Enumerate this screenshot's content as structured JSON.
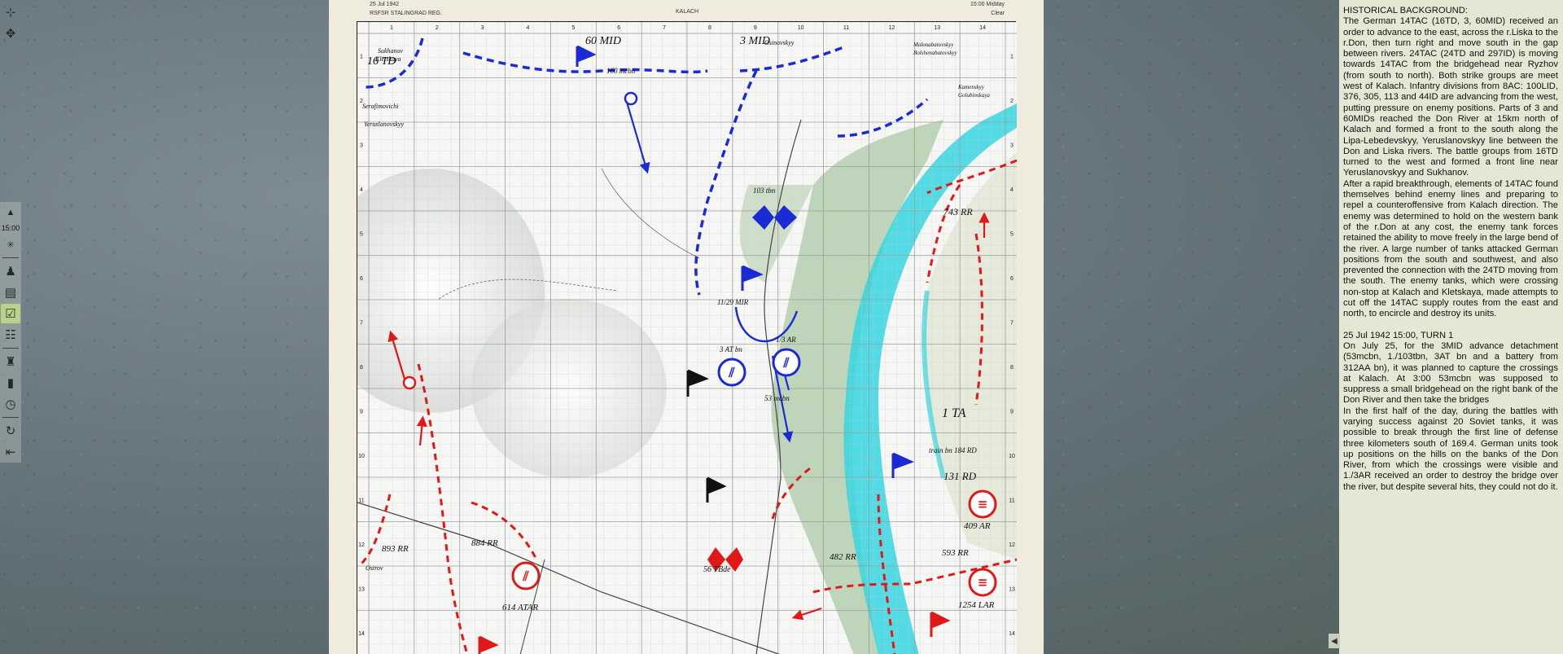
{
  "map": {
    "header": {
      "date": "25 Jul 1942",
      "region": "RSFSR STALINGRAD REG.",
      "title": "KALACH",
      "time": "15:00 Midday",
      "weather": "Clear"
    },
    "col_labels": [
      "1",
      "2",
      "3",
      "4",
      "5",
      "6",
      "7",
      "8",
      "9",
      "10",
      "11",
      "12",
      "13",
      "14"
    ],
    "row_labels": [
      "1",
      "2",
      "3",
      "4",
      "5",
      "6",
      "7",
      "8",
      "9",
      "10",
      "11",
      "12",
      "13",
      "14"
    ],
    "places": [
      "Sukhanov",
      "Kletskaya",
      "Serafimovichi",
      "Yeruslanovskyy",
      "Osinovskyy",
      "Malonabatovskyy",
      "Bolshenabatovskyy",
      "Kamenskyy",
      "Golubinskaya",
      "Ostrov"
    ],
    "units_german": [
      "60 MID",
      "3 MID",
      "16 TD",
      "160 mcbn",
      "103 tbn",
      "11/29 MIR",
      "3 AT bn",
      "1/3 AR",
      "53 mcbn"
    ],
    "units_soviet": [
      "743 RR",
      "1 TA",
      "train bn 184 RD",
      "131 RD",
      "409 AR",
      "593 RR",
      "1254 LAR",
      "893 RR",
      "884 RR",
      "482 RR",
      "56 TBde",
      "614 ATAR"
    ]
  },
  "sidebar": {
    "time": "15:00",
    "icons": [
      "move-icon",
      "unit-icon",
      "sun-icon",
      "soldier-icon",
      "map-icon",
      "check-icon",
      "hierarchy-icon",
      "units-icon",
      "strength-icon",
      "clock-icon",
      "rotate-icon",
      "exit-icon"
    ]
  },
  "briefing": {
    "heading": "HISTORICAL BACKGROUND:",
    "paragraph1": "The German 14TAC (16TD, 3, 60MID) received an order to advance to the east, across the r.Liska to the r.Don, then turn right and move south in the gap between rivers. 24TAC (24TD and 297ID) is moving towards 14TAC from the bridgehead near Ryzhov (from south to north). Both strike groups are meet west of Kalach. Infantry divisions from 8AC: 100LID, 376, 305, 113 and 44ID are advancing from the west, putting pressure on enemy positions. Parts of 3 and 60MIDs reached the Don River at 15km north of Kalach and formed a front to the south along the Lipa-Lebedevskyy, Yeruslanovskyy line between the Don and Liska rivers. The battle groups from 16TD turned to the west and formed a front line near Yeruslanovskyy and Sukhanov.",
    "paragraph2": "After a rapid breakthrough, elements of 14TAC found themselves behind enemy lines and preparing to repel a counteroffensive from Kalach direction. The enemy was determined to hold on the western bank of the r.Don at any cost, the enemy tank forces retained the ability to move freely in the large bend of the river. A large number of tanks attacked German positions from the south and southwest, and also prevented the connection with the 24TD moving from the south. The enemy tanks, which were crossing non-stop at Kalach and Kletskaya, made attempts to cut off the 14TAC supply routes from the east and north, to encircle and destroy its units.",
    "turn_line": "25 Jul 1942  15:00, TURN 1",
    "paragraph3": "On July 25, for the 3MID advance detachment (53mcbn, 1./103tbn, 3AT bn and a battery from 312AA bn), it was planned to capture the crossings at Kalach. At 3:00 53mcbn was supposed to suppress a small bridgehead on the right bank of the Don River and then take the bridges",
    "paragraph4": "In the first half of the day, during the battles with varying success against 20 Soviet tanks, it was possible to break through the first line of defense three kilometers south of 169.4. German units took up positions on the hills on the banks of the Don River, from which the crossings were visible and 1./3AR received an order to destroy the bridge over the river, but despite several hits, they could not do it."
  },
  "colors": {
    "german": "#1a2bd6",
    "soviet": "#e01818",
    "river": "#35d6e0",
    "panel": "#e4e7d4"
  }
}
